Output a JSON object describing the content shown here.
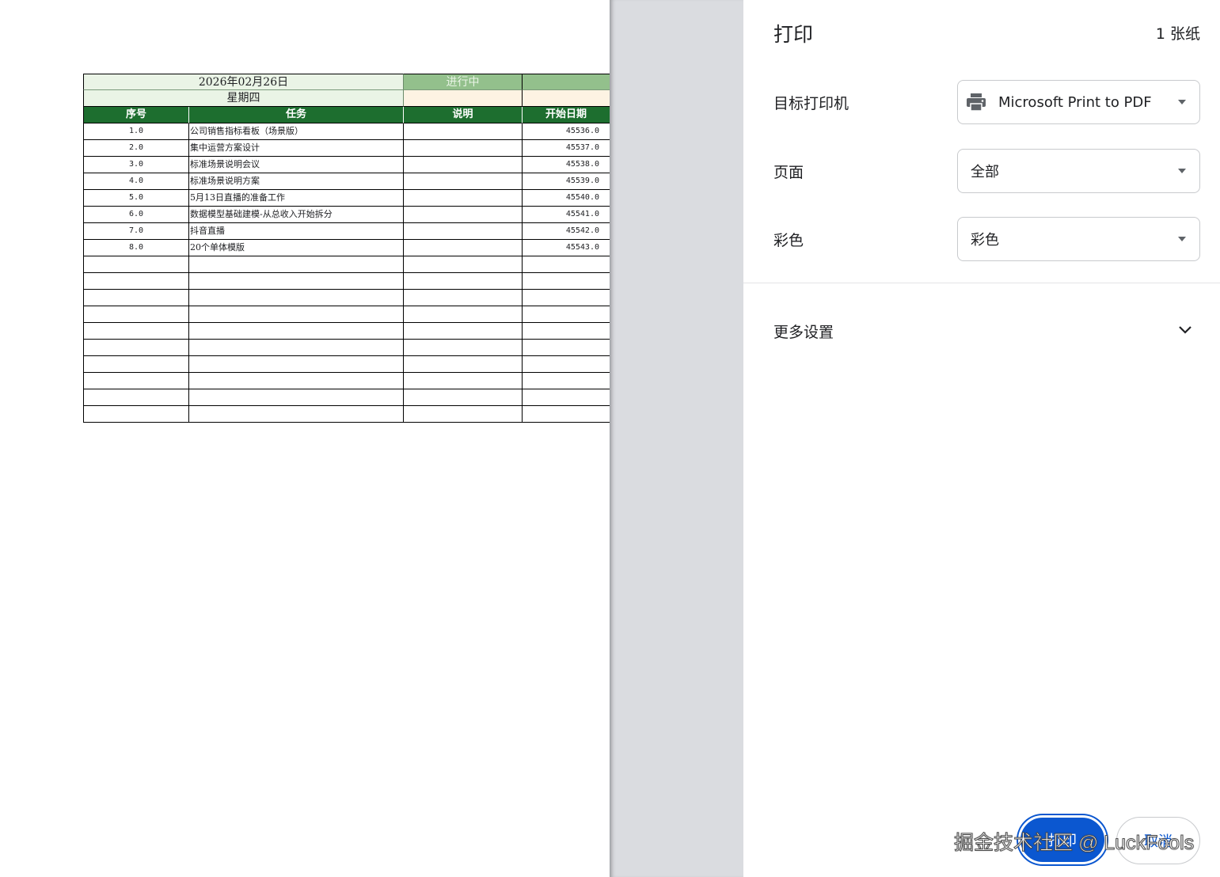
{
  "preview": {
    "date_text": "2026年02月26日",
    "status_text": "进行中",
    "weekday_text": "星期四",
    "headers": [
      "序号",
      "任务",
      "说明",
      "开始日期"
    ],
    "rows": [
      {
        "no": "1.0",
        "task": "公司销售指标看板（场景版）",
        "desc": "",
        "start": "45536.0"
      },
      {
        "no": "2.0",
        "task": "集中运营方案设计",
        "desc": "",
        "start": "45537.0"
      },
      {
        "no": "3.0",
        "task": "标准场景说明会议",
        "desc": "",
        "start": "45538.0"
      },
      {
        "no": "4.0",
        "task": "标准场景说明方案",
        "desc": "",
        "start": "45539.0"
      },
      {
        "no": "5.0",
        "task": "5月13日直播的准备工作",
        "desc": "",
        "start": "45540.0"
      },
      {
        "no": "6.0",
        "task": "数据模型基础建模-从总收入开始拆分",
        "desc": "",
        "start": "45541.0"
      },
      {
        "no": "7.0",
        "task": "抖音直播",
        "desc": "",
        "start": "45542.0"
      },
      {
        "no": "8.0",
        "task": "20个单体模版",
        "desc": "",
        "start": "45543.0"
      }
    ],
    "empty_row_count": 10,
    "colors": {
      "header_green": "#1d6e2f",
      "status_green": "#93c08c",
      "light_green": "#eaf4e6",
      "cream": "#fdf3e3"
    }
  },
  "panel": {
    "title": "打印",
    "sheet_count": "1 张纸",
    "destination_label": "目标打印机",
    "destination_value": "Microsoft Print to PDF",
    "pages_label": "页面",
    "pages_value": "全部",
    "color_label": "彩色",
    "color_value": "彩色",
    "more_settings": "更多设置",
    "print_button": "打印",
    "cancel_button": "取消",
    "accent": "#0b57d0"
  },
  "watermark": "掘金技术社区 @ LuckFools"
}
